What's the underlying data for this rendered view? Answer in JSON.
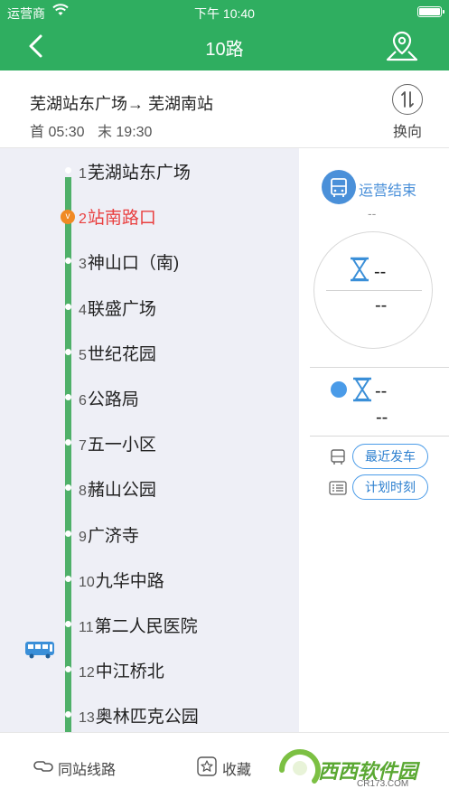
{
  "status_bar": {
    "carrier": "运营商",
    "time": "下午 10:40"
  },
  "nav": {
    "title": "10路",
    "back_icon": "chevron-left-icon",
    "location_icon": "map-pin-icon"
  },
  "route": {
    "name": "芜湖站东广场→ 芜湖南站",
    "first_label": "首 05:30",
    "last_label": "末 19:30",
    "reverse_label": "换向"
  },
  "stops": [
    {
      "num": "1",
      "name": "芜湖站东广场"
    },
    {
      "num": "2",
      "name": "站南路口",
      "current": true
    },
    {
      "num": "3",
      "name": "神山口（南)"
    },
    {
      "num": "4",
      "name": "联盛广场"
    },
    {
      "num": "5",
      "name": "世纪花园"
    },
    {
      "num": "6",
      "name": "公路局"
    },
    {
      "num": "7",
      "name": "五一小区"
    },
    {
      "num": "8",
      "name": "赭山公园"
    },
    {
      "num": "9",
      "name": "广济寺"
    },
    {
      "num": "10",
      "name": "九华中路"
    },
    {
      "num": "11",
      "name": "第二人民医院"
    },
    {
      "num": "12",
      "name": "中江桥北"
    },
    {
      "num": "13",
      "name": "奥林匹克公园"
    }
  ],
  "current_marker": "v",
  "service": {
    "status": "运营结束",
    "sub": "--"
  },
  "eta": {
    "primary": "--",
    "primary_sub": "--",
    "next": "--",
    "next_sub": "--"
  },
  "actions": {
    "recent_departure": "最近发车",
    "schedule": "计划时刻"
  },
  "bottom": {
    "same_station": "同站线路",
    "favorite": "收藏"
  },
  "watermark": {
    "text": "西西软件园",
    "url": "CR173.COM"
  },
  "colors": {
    "header_green": "#2fae60",
    "route_line": "#4fb069",
    "current_stop": "#e94040",
    "accent_blue": "#4a90d9"
  }
}
